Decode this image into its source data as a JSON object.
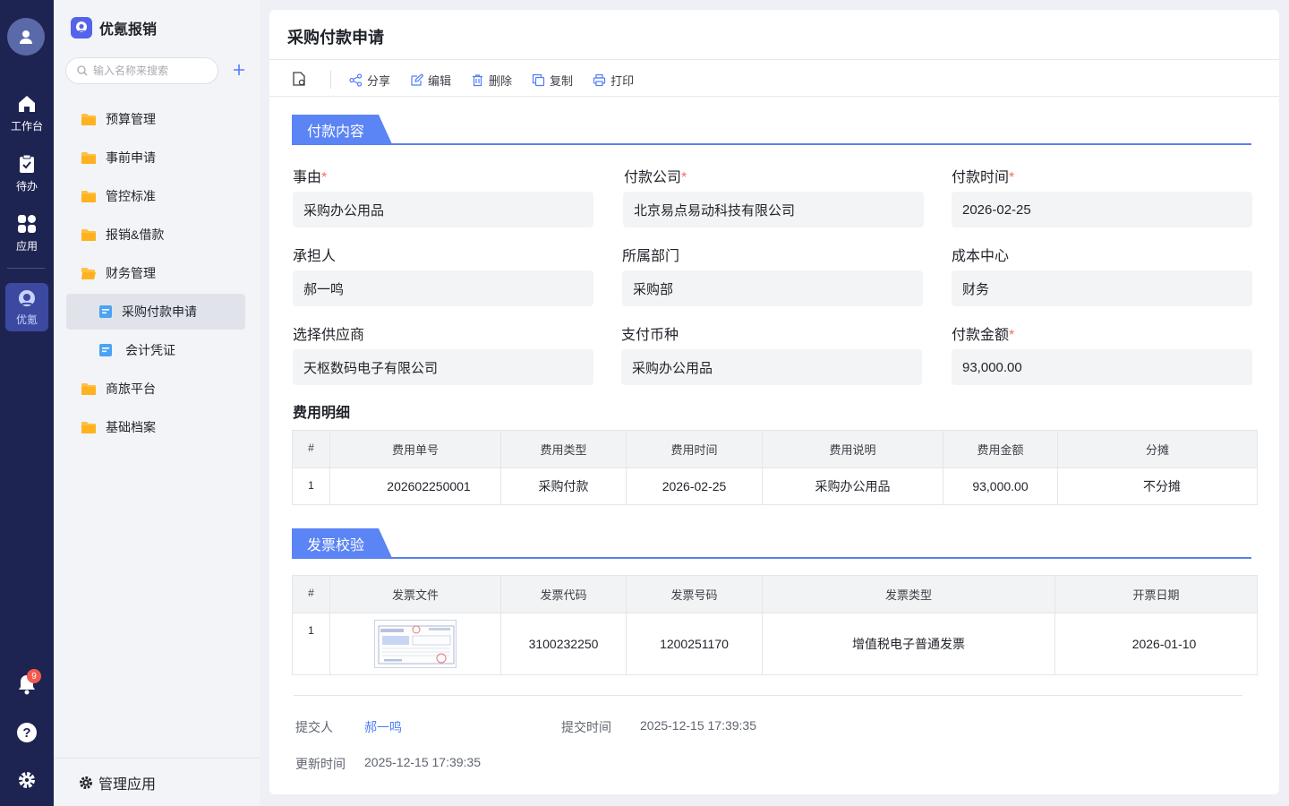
{
  "rail": {
    "items": [
      {
        "label": "工作台",
        "icon": "home-icon"
      },
      {
        "label": "待办",
        "icon": "clipboard-check-icon"
      },
      {
        "label": "应用",
        "icon": "apps-grid-icon"
      },
      {
        "label": "优氪",
        "icon": "youke-logo-icon"
      }
    ],
    "notification_count": "9"
  },
  "sidebar": {
    "brand": "优氪报销",
    "search_placeholder": "输入名称来搜索",
    "items": [
      {
        "label": "预算管理"
      },
      {
        "label": "事前申请"
      },
      {
        "label": "管控标准"
      },
      {
        "label": "报销&借款"
      },
      {
        "label": "财务管理"
      },
      {
        "label": "采购付款申请"
      },
      {
        "label": "会计凭证"
      },
      {
        "label": "商旅平台"
      },
      {
        "label": "基础档案"
      }
    ],
    "manage_label": "管理应用"
  },
  "main": {
    "title": "采购付款申请",
    "toolbar": {
      "share": "分享",
      "edit": "编辑",
      "delete": "删除",
      "copy": "复制",
      "print": "打印"
    },
    "section1": "付款内容",
    "fields": [
      {
        "label": "事由",
        "required": "*",
        "value": "采购办公用品"
      },
      {
        "label": "付款公司",
        "required": "*",
        "value": "北京易点易动科技有限公司"
      },
      {
        "label": "付款时间",
        "required": "*",
        "value": "2026-02-25"
      },
      {
        "label": "承担人",
        "required": "",
        "value": "郝一鸣"
      },
      {
        "label": "所属部门",
        "required": "",
        "value": "采购部"
      },
      {
        "label": "成本中心",
        "required": "",
        "value": "财务"
      },
      {
        "label": "选择供应商",
        "required": "",
        "value": "天枢数码电子有限公司"
      },
      {
        "label": "支付币种",
        "required": "",
        "value": "采购办公用品"
      },
      {
        "label": "付款金额",
        "required": "*",
        "value": "93,000.00"
      }
    ],
    "expense_title": "费用明细",
    "expense_table": {
      "headers": [
        "#",
        "费用单号",
        "费用类型",
        "费用时间",
        "费用说明",
        "费用金额",
        "分摊"
      ],
      "rows": [
        [
          "1",
          "202602250001",
          "采购付款",
          "2026-02-25",
          "采购办公用品",
          "93,000.00",
          "不分摊"
        ]
      ]
    },
    "section2": "发票校验",
    "invoice_table": {
      "headers": [
        "#",
        "发票文件",
        "发票代码",
        "发票号码",
        "发票类型",
        "开票日期"
      ],
      "rows": [
        [
          "1",
          "",
          "3100232250",
          "1200251170",
          "增值税电子普通发票",
          "2026-01-10"
        ]
      ]
    },
    "meta": {
      "submitter_label": "提交人",
      "submitter": "郝一鸣",
      "submit_time_label": "提交时间",
      "submit_time": "2025-12-15 17:39:35",
      "update_time_label": "更新时间",
      "update_time": "2025-12-15 17:39:35"
    }
  }
}
